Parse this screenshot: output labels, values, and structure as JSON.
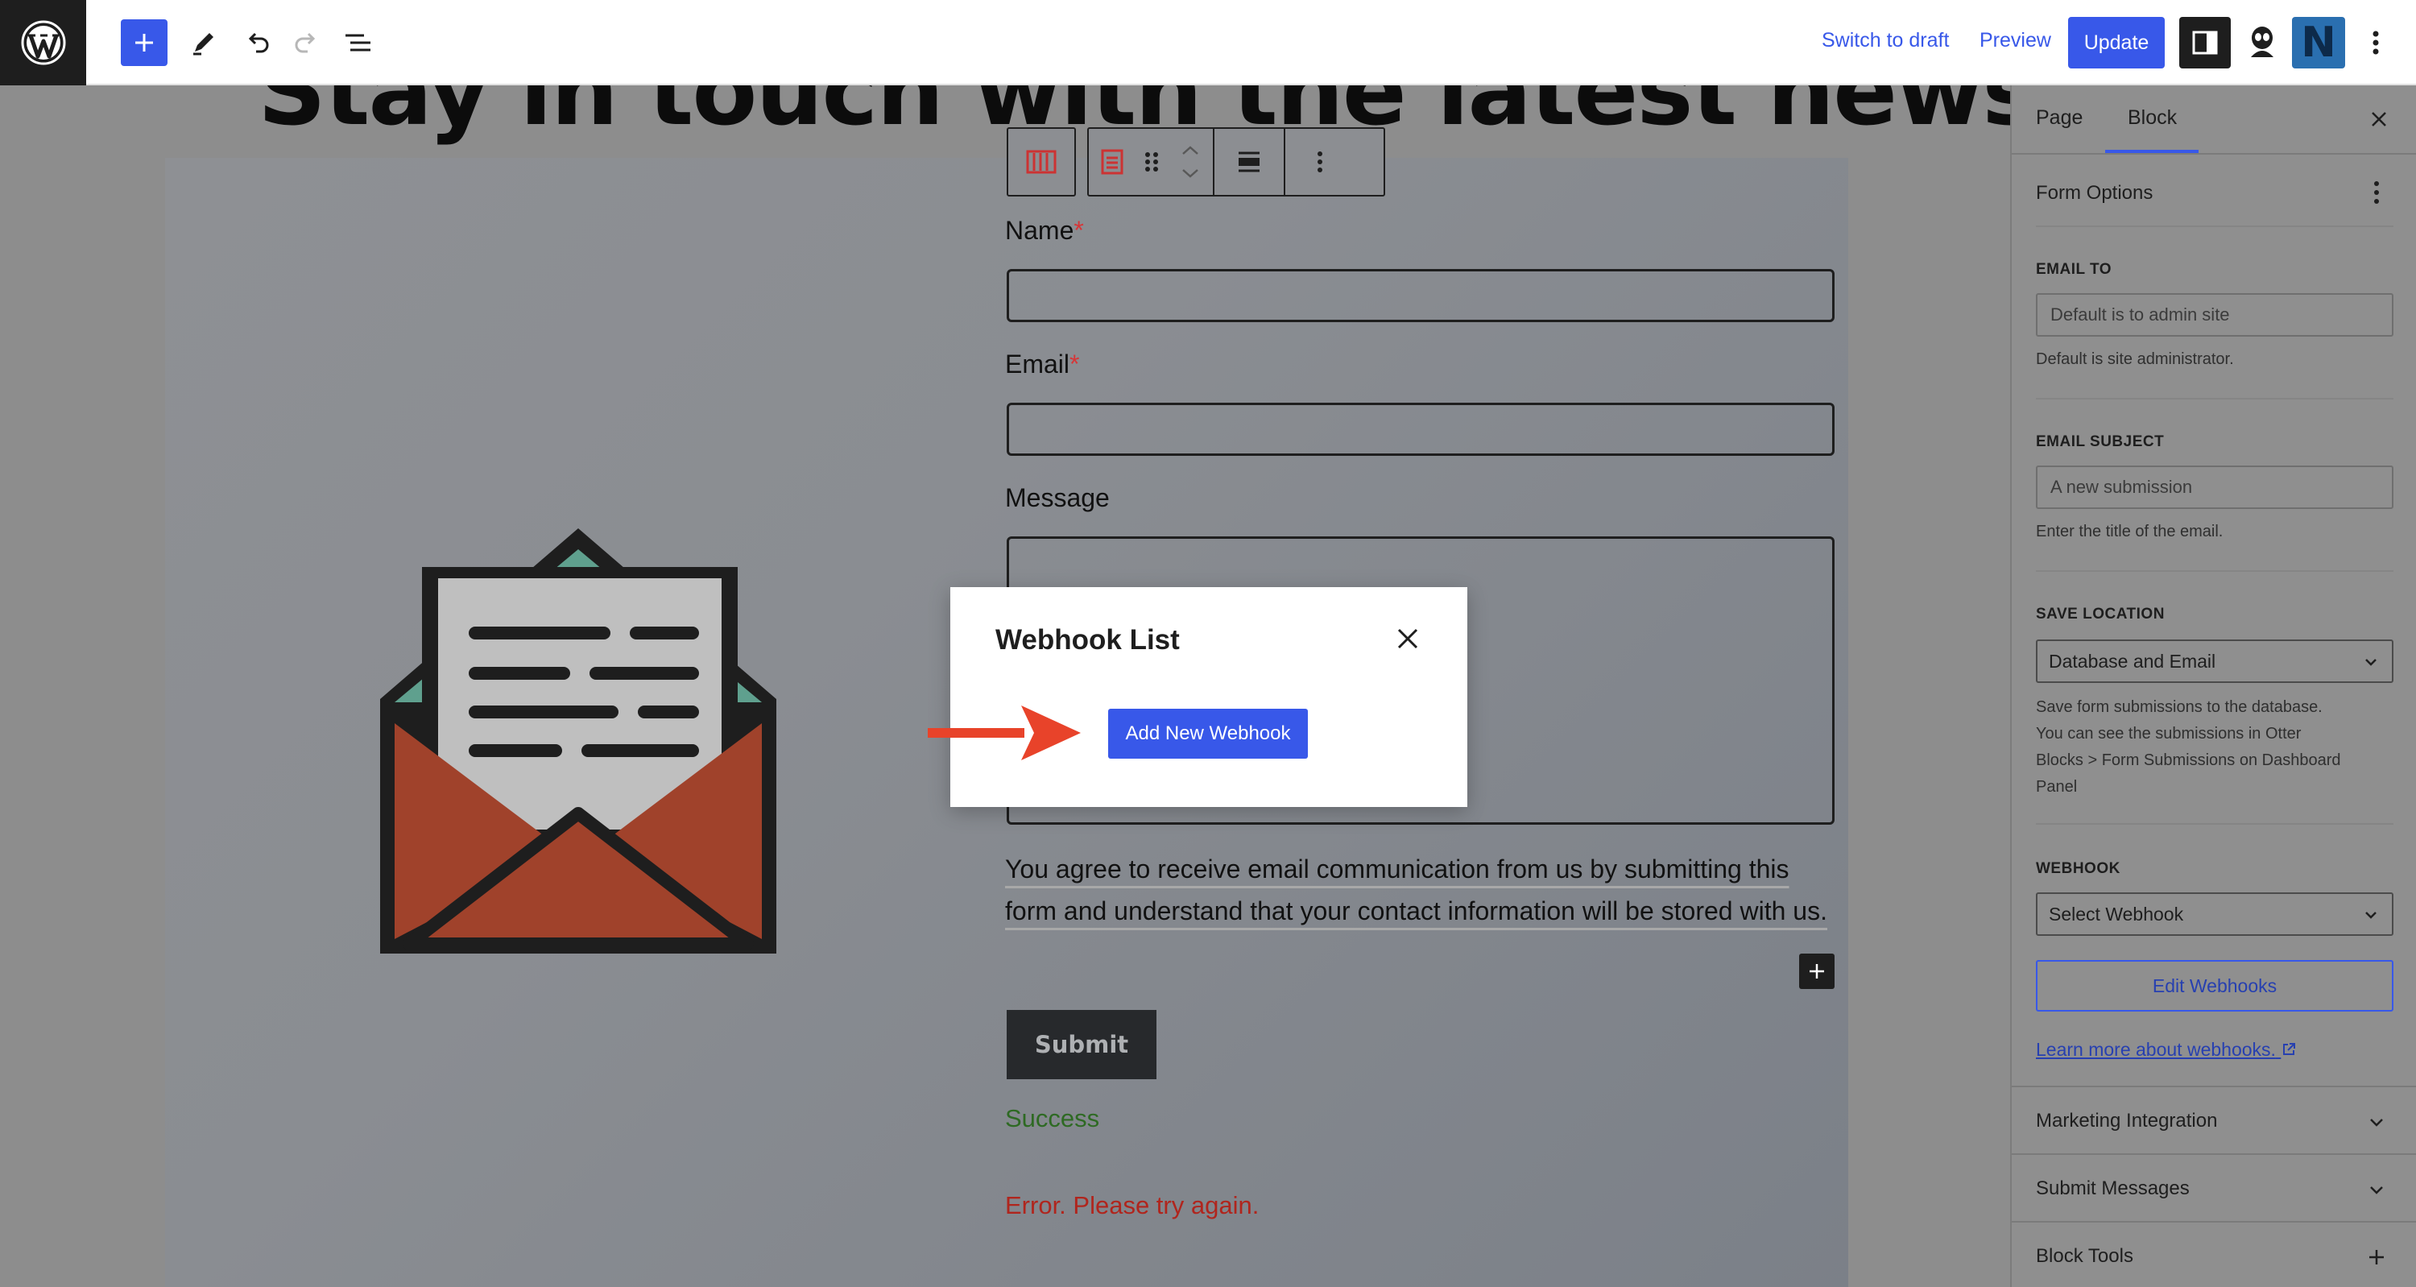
{
  "toolbar": {
    "switch_to_draft": "Switch to draft",
    "preview": "Preview",
    "update": "Update",
    "icons": [
      "wordpress-logo",
      "plus-icon",
      "pencil-icon",
      "undo-icon",
      "redo-icon",
      "list-view-icon",
      "sidebar-toggle-icon",
      "plugin-icon",
      "n-logo",
      "more-vertical-icon"
    ]
  },
  "canvas": {
    "heading": "Stay in touch with the latest news!",
    "form": {
      "name_label": "Name",
      "email_label": "Email",
      "message_label": "Message",
      "required_mark": "*",
      "consent_text": "You agree to receive email communication from us by submitting this form and understand that your contact information will be stored with us.",
      "submit": "Submit",
      "success": "Success",
      "error": "Error. Please try again."
    }
  },
  "modal": {
    "title": "Webhook List",
    "add_button": "Add New Webhook"
  },
  "sidebar": {
    "tabs": {
      "page": "Page",
      "block": "Block"
    },
    "form_options": "Form Options",
    "email_to": {
      "label": "EMAIL TO",
      "placeholder": "Default is to admin site",
      "help": "Default is site administrator."
    },
    "email_subject": {
      "label": "EMAIL SUBJECT",
      "placeholder": "A new submission",
      "help": "Enter the title of the email."
    },
    "save_location": {
      "label": "SAVE LOCATION",
      "value": "Database and Email",
      "help_line1": "Save form submissions to the database.",
      "help_line2": "You can see the submissions in Otter",
      "help_line3": "Blocks > Form Submissions on Dashboard",
      "help_line4": "Panel"
    },
    "webhook": {
      "label": "WEBHOOK",
      "value": "Select Webhook",
      "edit_button": "Edit Webhooks",
      "learn_more": "Learn more about webhooks."
    },
    "sections": {
      "marketing": "Marketing Integration",
      "submit_messages": "Submit Messages",
      "block_tools": "Block Tools"
    }
  },
  "colors": {
    "accent": "#3858e9",
    "overlay": "#8f8f8f",
    "arrow": "#e8432a",
    "envelope": "#a0422b"
  }
}
